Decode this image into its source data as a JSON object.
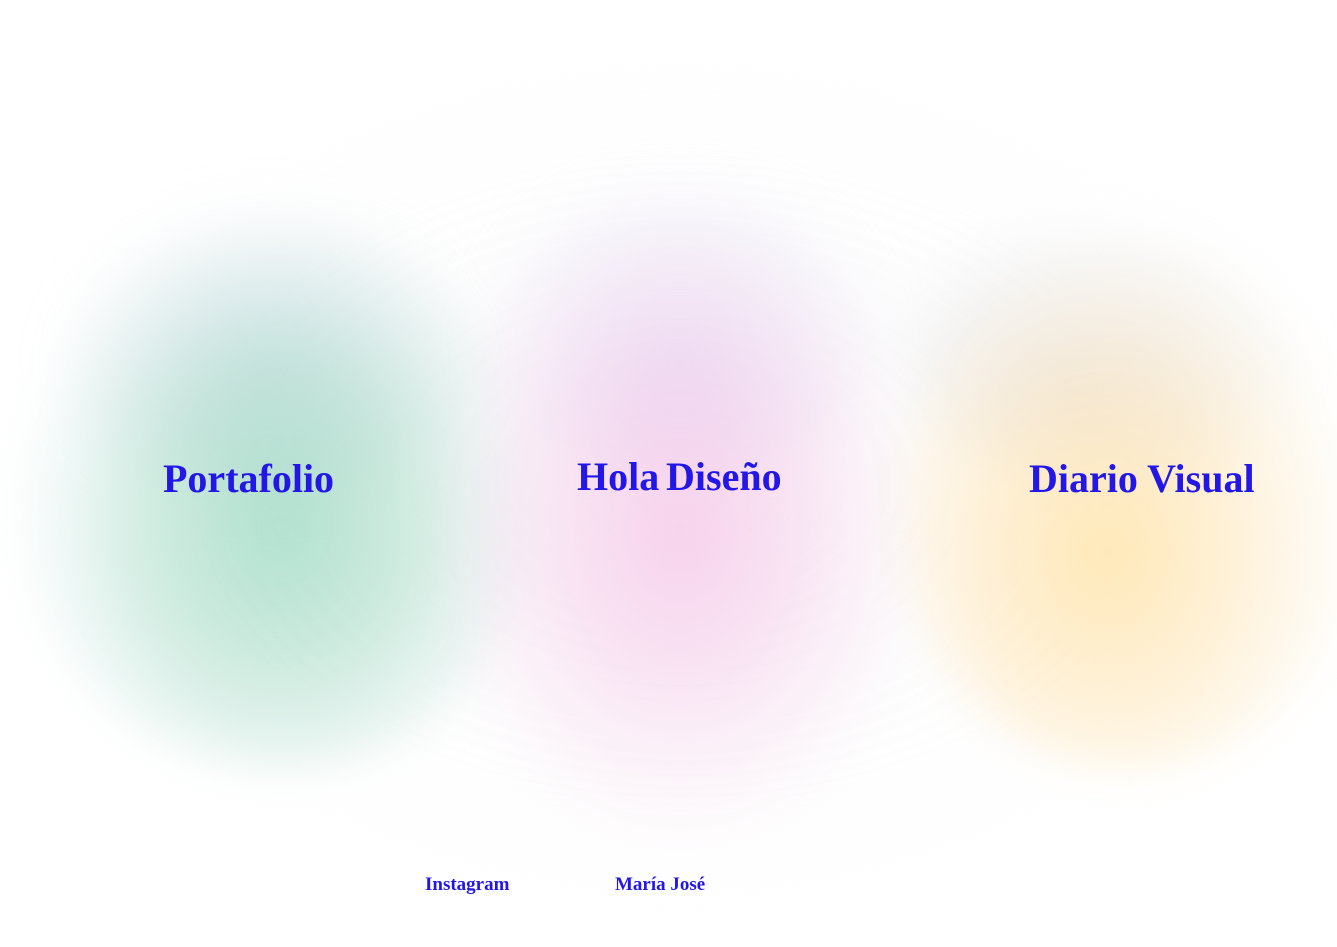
{
  "nav": {
    "portfolio_label": "Portafolio",
    "greeting_label": "Hola",
    "design_label": "Diseño",
    "journal_label": "Diario Visual"
  },
  "footer": {
    "instagram_label": "Instagram",
    "author_label": "María José"
  },
  "colors": {
    "text": "#2317e8",
    "background": "#ffffff",
    "blob_green": "#b4e2cf",
    "blob_pink": "#f6d6f0",
    "blob_yellow": "#ffebc0"
  }
}
